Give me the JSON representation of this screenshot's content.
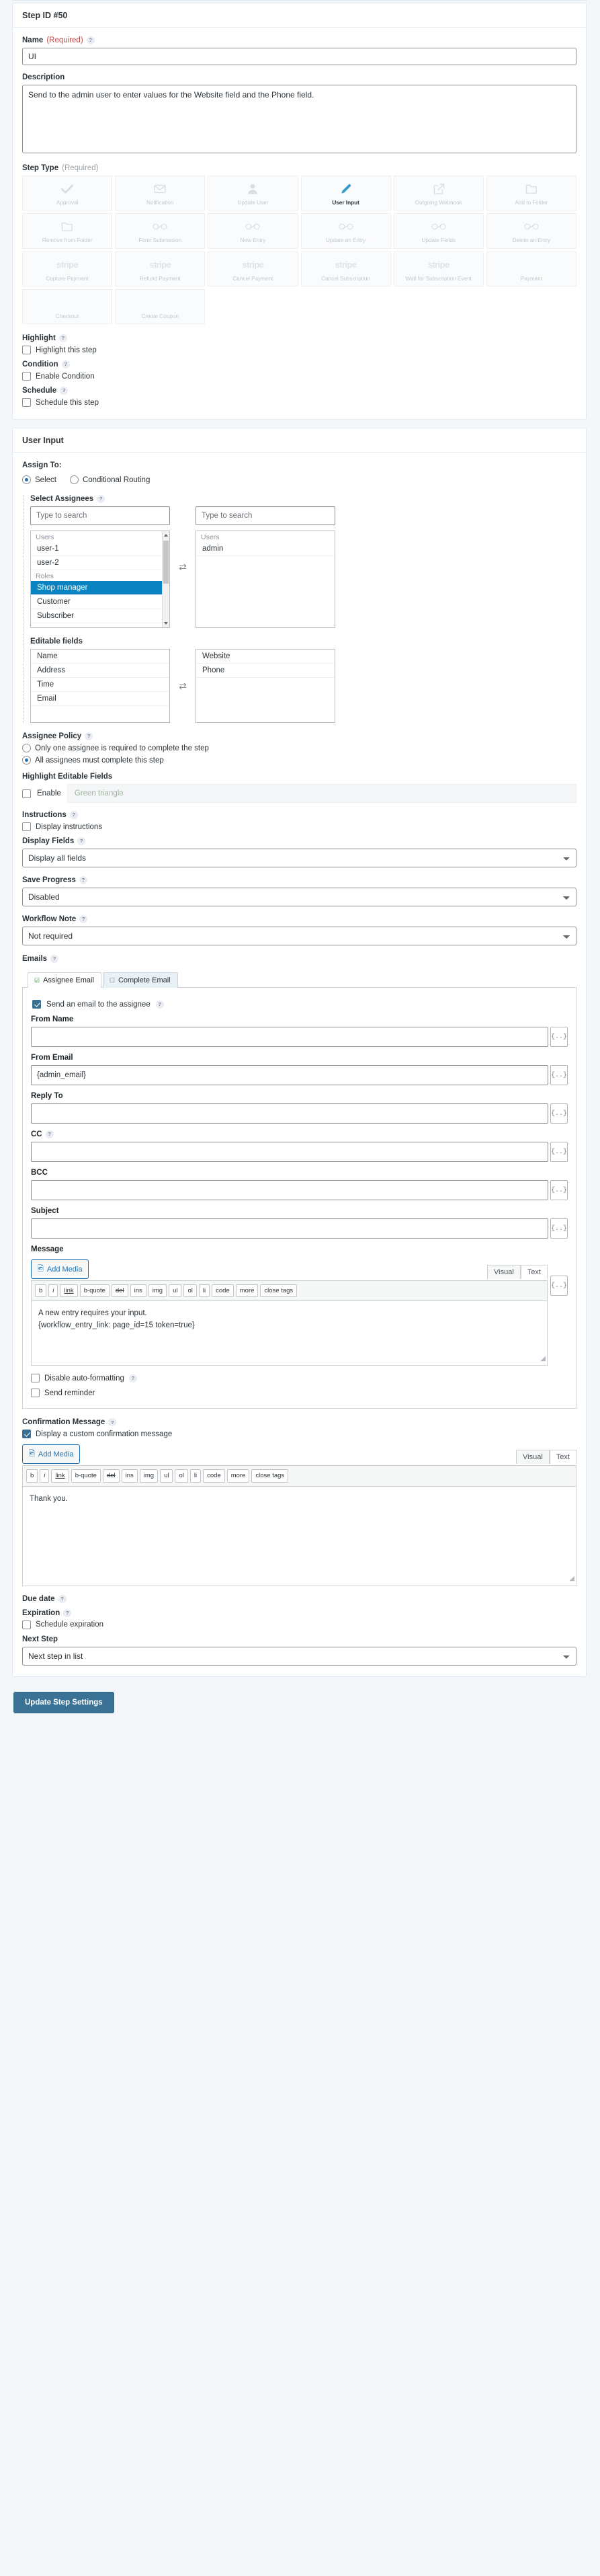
{
  "panel1": {
    "title": "Step ID #50",
    "name_label": "Name",
    "name_required": "(Required)",
    "name_value": "UI",
    "description_label": "Description",
    "description_value": "Send to the admin user to enter values for the Website field and the Phone field.",
    "steptype_label": "Step Type",
    "steptype_required": "(Required)",
    "step_types": [
      {
        "name": "Approval",
        "icon": "check-icon",
        "selected": false
      },
      {
        "name": "Notification",
        "icon": "envelope-icon",
        "selected": false
      },
      {
        "name": "Update User",
        "icon": "user-icon",
        "selected": false
      },
      {
        "name": "User Input",
        "icon": "pencil-icon",
        "selected": true
      },
      {
        "name": "Outgoing Webhook",
        "icon": "external-link-icon",
        "selected": false
      },
      {
        "name": "Add to Folder",
        "icon": "folder-icon",
        "selected": false
      },
      {
        "name": "Remove from Folder",
        "icon": "folder-icon",
        "selected": false
      },
      {
        "name": "Form Submission",
        "icon": "link-icon",
        "selected": false
      },
      {
        "name": "New Entry",
        "icon": "link-icon",
        "selected": false
      },
      {
        "name": "Update an Entry",
        "icon": "link-icon",
        "selected": false
      },
      {
        "name": "Update Fields",
        "icon": "link-icon",
        "selected": false
      },
      {
        "name": "Delete an Entry",
        "icon": "link-icon",
        "selected": false
      },
      {
        "name": "Capture Payment",
        "icon": "stripe-icon",
        "selected": false
      },
      {
        "name": "Refund Payment",
        "icon": "stripe-icon",
        "selected": false
      },
      {
        "name": "Cancel Payment",
        "icon": "stripe-icon",
        "selected": false
      },
      {
        "name": "Cancel Subscription",
        "icon": "stripe-icon",
        "selected": false
      },
      {
        "name": "Wait for Subscription Event",
        "icon": "stripe-icon",
        "selected": false
      },
      {
        "name": "Payment",
        "icon": "blank-icon",
        "selected": false
      },
      {
        "name": "Checkout",
        "icon": "blank-icon",
        "selected": false
      },
      {
        "name": "Create Coupon",
        "icon": "blank-icon",
        "selected": false
      }
    ],
    "highlight_label": "Highlight",
    "highlight_checkbox": "Highlight this step",
    "condition_label": "Condition",
    "condition_checkbox": "Enable Condition",
    "schedule_label": "Schedule",
    "schedule_checkbox": "Schedule this step"
  },
  "panel2": {
    "title": "User Input",
    "assign_to_label": "Assign To:",
    "assign_select": "Select",
    "assign_conditional": "Conditional Routing",
    "select_assignees_label": "Select Assignees",
    "search_placeholder": "Type to search",
    "available": {
      "groups": [
        {
          "group": "Users",
          "items": [
            "user-1",
            "user-2"
          ]
        },
        {
          "group": "Roles",
          "items": [
            "Shop manager",
            "Customer",
            "Subscriber"
          ]
        }
      ],
      "highlighted": "Shop manager"
    },
    "selected": {
      "groups": [
        {
          "group": "Users",
          "items": [
            "admin"
          ]
        }
      ]
    },
    "editable_fields_label": "Editable fields",
    "editable_available": [
      "Name",
      "Address",
      "Time",
      "Email"
    ],
    "editable_selected": [
      "Website",
      "Phone"
    ],
    "assignee_policy_label": "Assignee Policy",
    "policy_one": "Only one assignee is required to complete the step",
    "policy_all": "All assignees must complete this step",
    "highlight_editable_label": "Highlight Editable Fields",
    "enable_label": "Enable",
    "green_triangle": "Green triangle",
    "instructions_label": "Instructions",
    "display_instructions": "Display instructions",
    "display_fields_label": "Display Fields",
    "display_fields_value": "Display all fields",
    "save_progress_label": "Save Progress",
    "save_progress_value": "Disabled",
    "workflow_note_label": "Workflow Note",
    "workflow_note_value": "Not required",
    "emails_label": "Emails",
    "tab_assignee": "Assignee Email",
    "tab_complete": "Complete Email",
    "send_email_checkbox": "Send an email to the assignee",
    "from_name_label": "From Name",
    "from_name_value": "",
    "from_email_label": "From Email",
    "from_email_value": "{admin_email}",
    "reply_to_label": "Reply To",
    "reply_to_value": "",
    "cc_label": "CC",
    "cc_value": "",
    "bcc_label": "BCC",
    "bcc_value": "",
    "subject_label": "Subject",
    "subject_value": "",
    "message_label": "Message",
    "add_media": "Add Media",
    "visual_tab": "Visual",
    "text_tab": "Text",
    "quicktags": [
      "b",
      "i",
      "link",
      "b-quote",
      "del",
      "ins",
      "img",
      "ul",
      "ol",
      "li",
      "code",
      "more",
      "close tags"
    ],
    "message_body_line1": "A new entry requires your input.",
    "message_body_line2": "{workflow_entry_link: page_id=15 token=true}",
    "disable_autoformat": "Disable auto-formatting",
    "send_reminder": "Send reminder",
    "confirmation_label": "Confirmation Message",
    "confirmation_checkbox": "Display a custom confirmation message",
    "confirmation_body": "Thank you.",
    "due_date_label": "Due date",
    "expiration_label": "Expiration",
    "schedule_expiration": "Schedule expiration",
    "next_step_label": "Next Step",
    "next_step_value": "Next step in list",
    "token_button": "{..}"
  },
  "footer": {
    "update_button": "Update Step Settings"
  },
  "colors": {
    "accent": "#3a7295",
    "selected_blue": "#3699cc",
    "highlight_row": "#0a84c1",
    "required_red": "#b94a48"
  }
}
